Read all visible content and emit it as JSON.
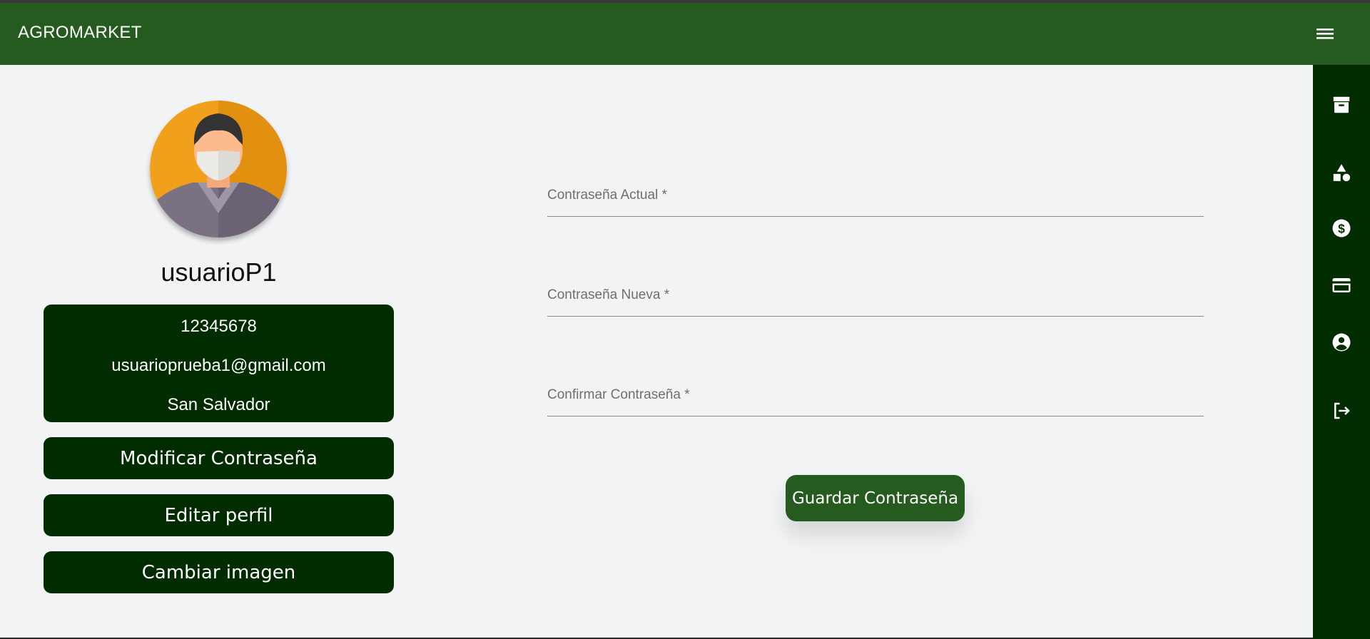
{
  "header": {
    "title": "AGROMARKET",
    "menu_icon": "hamburger-menu-icon"
  },
  "side_rail": {
    "items": [
      {
        "icon": "archive-icon"
      },
      {
        "icon": "category-shapes-icon"
      },
      {
        "icon": "dollar-circle-icon"
      },
      {
        "icon": "credit-card-icon"
      },
      {
        "icon": "account-circle-icon"
      },
      {
        "icon": "logout-icon"
      }
    ]
  },
  "profile": {
    "avatar_icon": "user-avatar-masked-man",
    "username": "usuarioP1",
    "info": {
      "phone": "12345678",
      "email": "usuarioprueba1@gmail.com",
      "location": "San Salvador"
    },
    "buttons": {
      "change_password": "Modificar Contraseña",
      "edit_profile": "Editar perfil",
      "change_image": "Cambiar imagen"
    }
  },
  "password_form": {
    "current_label": "Contraseña Actual *",
    "new_label": "Contraseña Nueva *",
    "confirm_label": "Confirmar Contraseña *",
    "save_label": "Guardar Contraseña"
  },
  "colors": {
    "header": "#255b1f",
    "dark_green": "#002c00",
    "background": "#f1f3f5",
    "avatar_bg": "#f0a01a"
  }
}
